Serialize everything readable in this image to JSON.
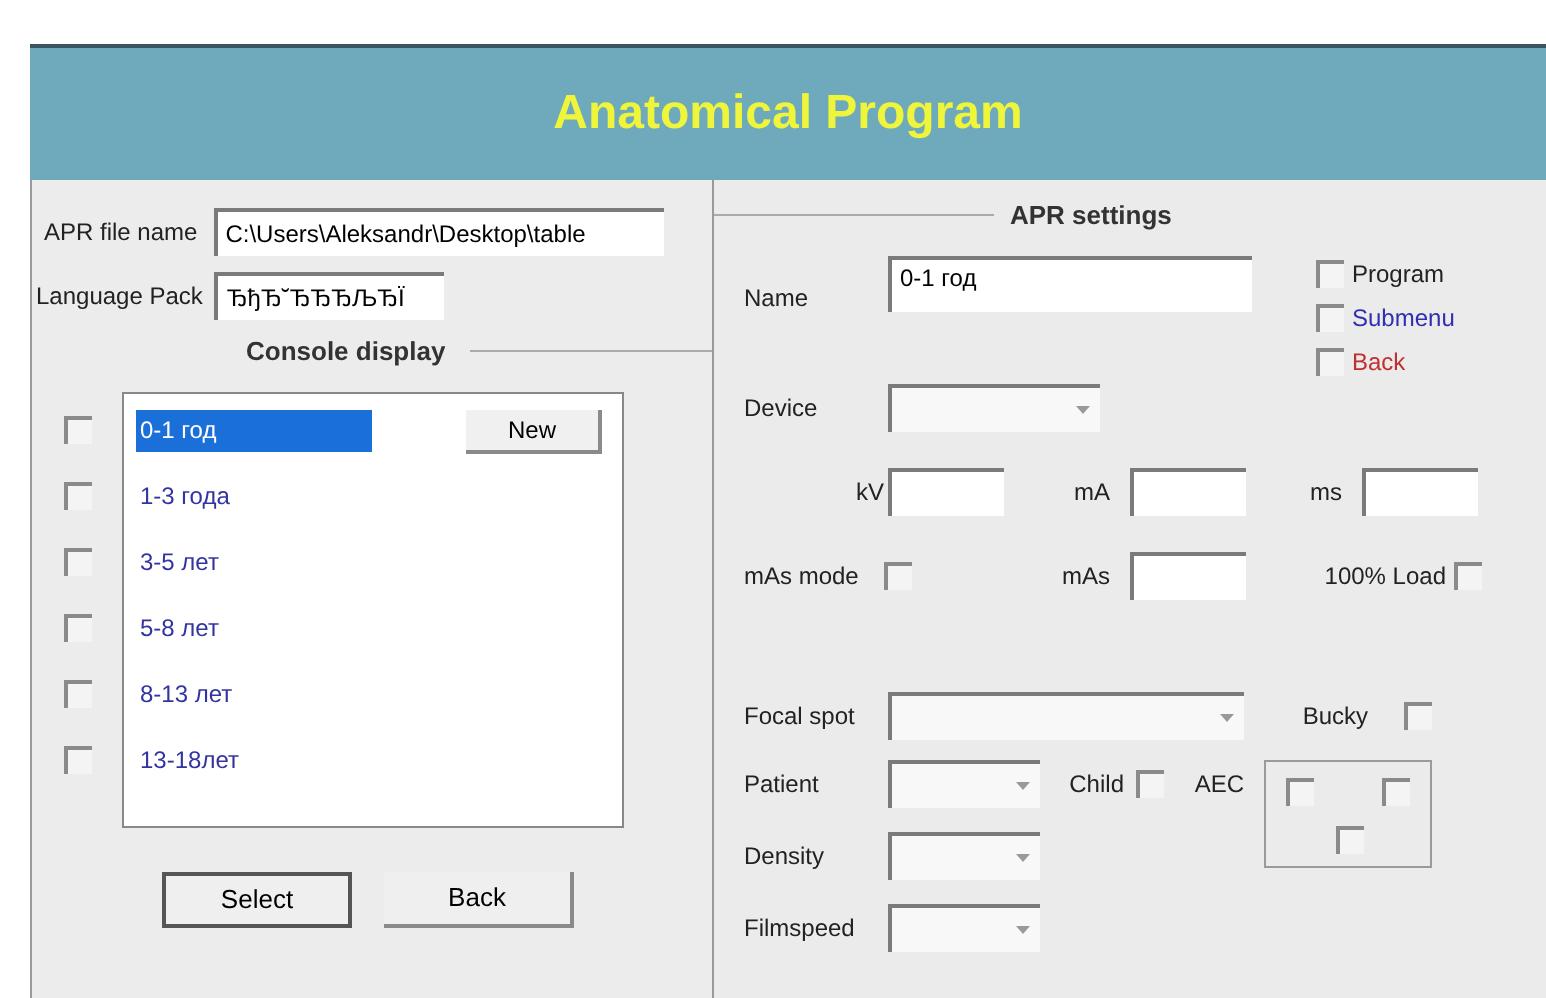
{
  "window": {
    "title": "Anatomical Program"
  },
  "apr_file": {
    "label": "APR file name",
    "value": "C:\\Users\\Aleksandr\\Desktop\\table"
  },
  "language_pack": {
    "label": "Language Pack",
    "value": "ЂђЂ˘ЂЂЂЉЂЇ"
  },
  "console_display": {
    "title": "Console display",
    "new_button": "New",
    "items": [
      {
        "label": "0-1 год",
        "selected": true,
        "checked": false
      },
      {
        "label": "1-3 года",
        "selected": false,
        "checked": false
      },
      {
        "label": "3-5 лет",
        "selected": false,
        "checked": false
      },
      {
        "label": "5-8 лет",
        "selected": false,
        "checked": false
      },
      {
        "label": "8-13 лет",
        "selected": false,
        "checked": false
      },
      {
        "label": "13-18лет",
        "selected": false,
        "checked": false
      }
    ],
    "buttons": [
      "Select",
      "Back"
    ]
  },
  "apr_settings": {
    "title": "APR settings",
    "name": {
      "label": "Name",
      "value": "0-1 год"
    },
    "flags": [
      {
        "label": "Program",
        "checked": false,
        "color": "#222222"
      },
      {
        "label": "Submenu",
        "checked": false,
        "color": "#2f2fb0"
      },
      {
        "label": "Back",
        "checked": false,
        "color": "#c03030"
      }
    ],
    "device": {
      "label": "Device"
    },
    "kv": {
      "label": "kV"
    },
    "ma": {
      "label": "mA"
    },
    "ms": {
      "label": "ms"
    },
    "mas_mode": {
      "label": "mAs mode",
      "checked": false
    },
    "mas": {
      "label": "mAs"
    },
    "full_load": {
      "label": "100% Load",
      "checked": false
    },
    "focal_spot": {
      "label": "Focal spot"
    },
    "bucky": {
      "label": "Bucky",
      "checked": false
    },
    "patient": {
      "label": "Patient"
    },
    "child": {
      "label": "Child",
      "checked": false
    },
    "aec": {
      "label": "AEC",
      "checks": [
        false,
        false,
        false
      ]
    },
    "density": {
      "label": "Density"
    },
    "filmspeed": {
      "label": "Filmspeed"
    }
  }
}
